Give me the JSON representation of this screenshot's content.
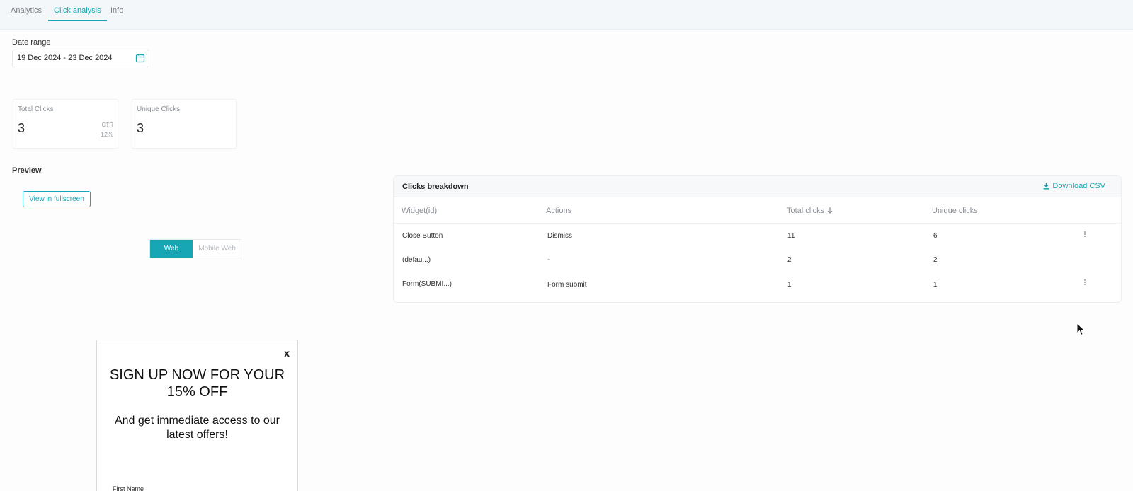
{
  "tabs": [
    {
      "label": "Analytics"
    },
    {
      "label": "Click analysis"
    },
    {
      "label": "Info"
    }
  ],
  "date_range": {
    "label": "Date range",
    "value": "19 Dec 2024 - 23 Dec 2024"
  },
  "metrics": {
    "total_clicks": {
      "label": "Total Clicks",
      "value": "3",
      "ctr_label": "CTR",
      "ctr_value": "12%"
    },
    "unique_clicks": {
      "label": "Unique Clicks",
      "value": "3"
    }
  },
  "preview": {
    "label": "Preview",
    "fullscreen_button": "View in fullscreen",
    "toggle": {
      "web": "Web",
      "mobile": "Mobile Web",
      "selected": "Web"
    }
  },
  "breakdown": {
    "title": "Clicks breakdown",
    "download": "Download CSV",
    "columns": [
      "Widget(id)",
      "Actions",
      "Total clicks",
      "Unique clicks"
    ],
    "rows": [
      {
        "widget": "Close Button",
        "action": "Dismiss",
        "total": "11",
        "unique": "6"
      },
      {
        "widget": "(defau...)",
        "action": "-",
        "total": "2",
        "unique": "2"
      },
      {
        "widget": "Form(SUBMI...)",
        "action": "Form submit",
        "total": "1",
        "unique": "1"
      }
    ]
  },
  "popup": {
    "close": "x",
    "headline": "SIGN UP NOW FOR YOUR 15% OFF",
    "subline": "And get immediate access to our latest offers!",
    "field_label": "First Name"
  },
  "colors": {
    "accent": "#16a6b4"
  }
}
